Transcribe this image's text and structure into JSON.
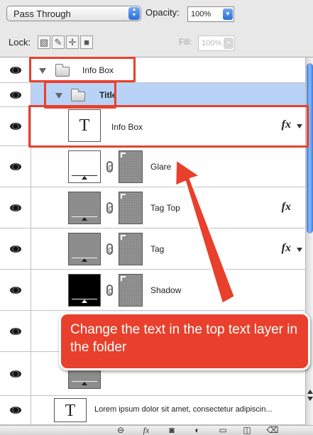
{
  "controls": {
    "blend_mode": "Pass Through",
    "opacity_label": "Opacity:",
    "opacity_value": "100%",
    "lock_label": "Lock:",
    "fill_label": "Fill:",
    "fill_value": "100%",
    "lock_icons": [
      "lock-transparent-icon",
      "lock-image-icon",
      "lock-position-icon",
      "lock-all-icon"
    ]
  },
  "layers": [
    {
      "name": "Info Box",
      "kind": "group",
      "expanded": true
    },
    {
      "name": "Title",
      "kind": "group",
      "expanded": true,
      "selected": true
    },
    {
      "name": "Info Box",
      "kind": "text",
      "thumb": "T",
      "fx": "fx"
    },
    {
      "name": "Glare",
      "kind": "masked"
    },
    {
      "name": "Tag Top",
      "kind": "masked",
      "fx": "fx"
    },
    {
      "name": "Tag",
      "kind": "masked",
      "fx": "fx"
    },
    {
      "name": "Shadow",
      "kind": "masked"
    },
    {
      "name": "Lorem ipsum dolor sit amet, consectetur adipiscin...",
      "kind": "text",
      "thumb": "T"
    }
  ],
  "annotation": {
    "callout_text": "Change the text in the top text layer in the folder",
    "accent_color": "#e8402c"
  },
  "bottom_icons": [
    "link-icon",
    "fx-icon",
    "mask-icon",
    "adjustment-icon",
    "new-group-icon",
    "new-layer-icon",
    "trash-icon"
  ],
  "colors": {
    "selection": "#b9d3f6",
    "scroll_thumb": "#3a7be0"
  }
}
